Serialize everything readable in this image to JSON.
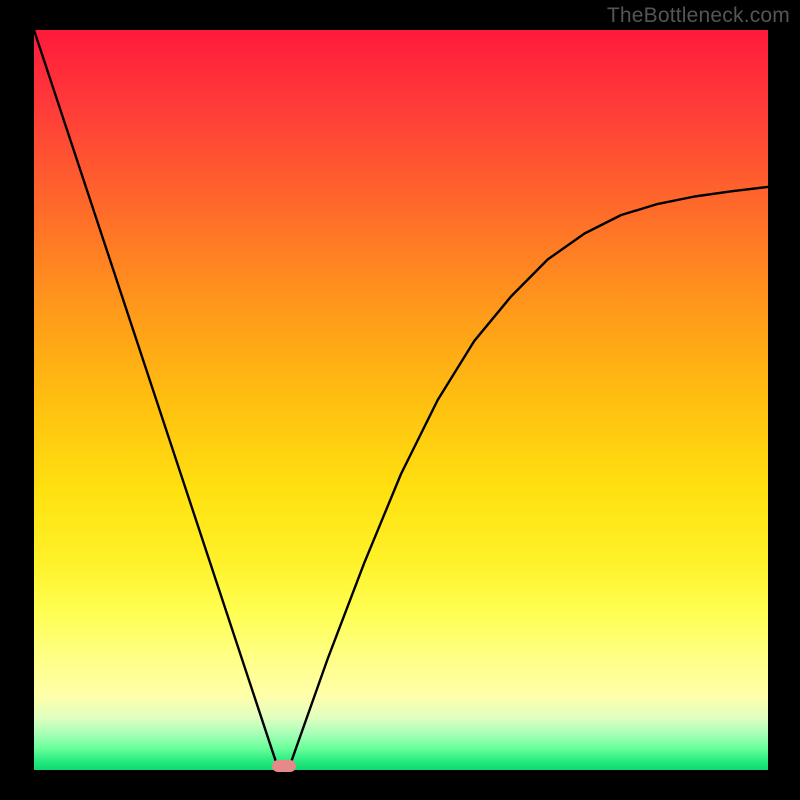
{
  "watermark": "TheBottleneck.com",
  "chart_data": {
    "type": "line",
    "title": "",
    "xlabel": "",
    "ylabel": "",
    "xlim": [
      0,
      100
    ],
    "ylim": [
      0,
      100
    ],
    "background_gradient": {
      "top_color": "#ff1a3a",
      "mid_color": "#ffe010",
      "bottom_color": "#10d872",
      "description": "red-orange-yellow-green vertical gradient (red high bottleneck, green low)"
    },
    "series": [
      {
        "name": "bottleneck-curve",
        "x": [
          0,
          5,
          10,
          15,
          20,
          25,
          30,
          33,
          34,
          35,
          40,
          45,
          50,
          55,
          60,
          65,
          70,
          75,
          80,
          85,
          90,
          95,
          100
        ],
        "y": [
          100,
          85,
          70,
          55,
          40,
          25,
          10,
          1,
          0,
          1,
          15,
          28,
          40,
          50,
          58,
          64,
          69,
          72.5,
          75,
          76.5,
          77.5,
          78.2,
          78.8
        ],
        "color": "#000000",
        "description": "V-shaped curve with minimum near x≈34; right branch approaches asymptote ~79%"
      }
    ],
    "markers": [
      {
        "name": "optimal-point",
        "x": 34,
        "y": 0,
        "shape": "rounded-rect",
        "color": "#e58a88"
      }
    ],
    "annotations": []
  }
}
